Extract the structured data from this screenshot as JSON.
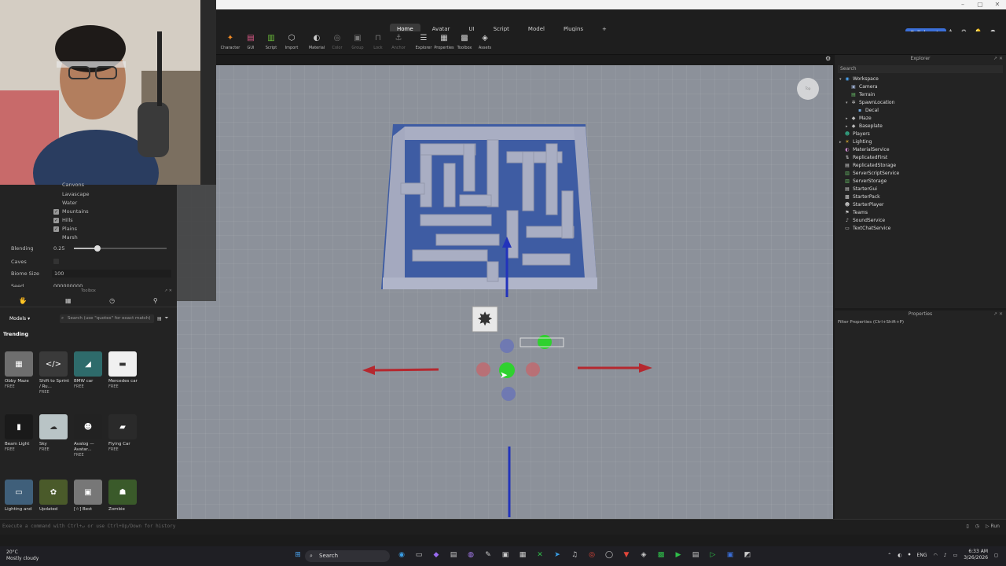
{
  "window": {
    "controls": [
      "–",
      "▢",
      "✕"
    ]
  },
  "ribbon": {
    "tabs": [
      {
        "label": "Home",
        "active": true
      },
      {
        "label": "Avatar"
      },
      {
        "label": "UI"
      },
      {
        "label": "Script"
      },
      {
        "label": "Model"
      },
      {
        "label": "Plugins"
      },
      {
        "label": "+"
      }
    ],
    "collaborate": "Collaborate",
    "tools": [
      {
        "label": "Character",
        "icon": "character-icon",
        "glyph": "✦",
        "color": "#f08a24"
      },
      {
        "label": "GUI",
        "icon": "gui-icon",
        "glyph": "▤",
        "color": "#e05a8a"
      },
      {
        "label": "Script",
        "icon": "script-icon",
        "glyph": "▥",
        "color": "#6bbf3a"
      },
      {
        "label": "Import",
        "icon": "import-icon",
        "glyph": "⬡",
        "color": "#cccccc"
      },
      {
        "label": "Material",
        "icon": "material-icon",
        "glyph": "◐",
        "color": "#cccccc"
      },
      {
        "label": "Color",
        "icon": "color-icon",
        "glyph": "◎",
        "color": "#777777",
        "dim": true
      },
      {
        "label": "Group",
        "icon": "group-icon",
        "glyph": "▣",
        "color": "#777777",
        "dim": true
      },
      {
        "label": "Lock",
        "icon": "lock-icon",
        "glyph": "⊓",
        "color": "#777777",
        "dim": true
      },
      {
        "label": "Anchor",
        "icon": "anchor-icon",
        "glyph": "⚓",
        "color": "#777777",
        "dim": true
      },
      {
        "label": "Explorer",
        "icon": "explorer-icon",
        "glyph": "☰",
        "color": "#cccccc"
      },
      {
        "label": "Properties",
        "icon": "properties-icon",
        "glyph": "▦",
        "color": "#cccccc"
      },
      {
        "label": "Toolbox",
        "icon": "toolbox-icon",
        "glyph": "▩",
        "color": "#cccccc"
      },
      {
        "label": "Assets",
        "icon": "assets-icon",
        "glyph": "◈",
        "color": "#cccccc"
      }
    ]
  },
  "terrain": {
    "options": [
      {
        "label": "Canyons",
        "checked": false
      },
      {
        "label": "Lavascape",
        "checked": false
      },
      {
        "label": "Water",
        "checked": false
      },
      {
        "label": "Mountains",
        "checked": true
      },
      {
        "label": "Hills",
        "checked": true
      },
      {
        "label": "Plains",
        "checked": true
      },
      {
        "label": "Marsh",
        "checked": false
      }
    ],
    "blending_label": "Blending",
    "blending_value": "0.25",
    "blending_fraction": 0.25,
    "caves_label": "Caves",
    "biome_size_label": "Biome Size",
    "biome_size_value": "100",
    "seed_label": "Seed",
    "seed_value": "000000000"
  },
  "toolbox": {
    "title": "Toolbox",
    "category": "Models",
    "search_placeholder": "Search (use \"quotes\" for exact match)",
    "section": "Trending",
    "items": [
      {
        "name": "Obby Maze",
        "price": "FREE",
        "glyph": "▦",
        "bg": "#6e6e6e"
      },
      {
        "name": "Shift to Sprint / Ru...",
        "price": "FREE",
        "glyph": "</>",
        "bg": "#3a3a3a"
      },
      {
        "name": "BMW car",
        "price": "FREE",
        "glyph": "◢",
        "bg": "#2e6b6b"
      },
      {
        "name": "Mercedes car",
        "price": "FREE",
        "glyph": "▬",
        "bg": "#f0f0f0"
      },
      {
        "name": "Beam Light",
        "price": "FREE",
        "glyph": "▮",
        "bg": "#1a1a1a"
      },
      {
        "name": "Sky",
        "price": "FREE",
        "glyph": "☁",
        "bg": "#b9c4c6"
      },
      {
        "name": "Avalog — Avatar...",
        "price": "FREE",
        "glyph": "☻",
        "bg": "#222222"
      },
      {
        "name": "Flying Car",
        "price": "FREE",
        "glyph": "▰",
        "bg": "#2a2a2a"
      },
      {
        "name": "Lighting and",
        "price": "",
        "glyph": "▭",
        "bg": "#3f5f7a"
      },
      {
        "name": "Updated",
        "price": "",
        "glyph": "✿",
        "bg": "#4a5a2a"
      },
      {
        "name": "[☆] Best",
        "price": "",
        "glyph": "▣",
        "bg": "#777777"
      },
      {
        "name": "Zombie",
        "price": "",
        "glyph": "☗",
        "bg": "#3a5a2a"
      }
    ]
  },
  "explorer": {
    "title": "Explorer",
    "search_placeholder": "Search",
    "tree": [
      {
        "label": "Workspace",
        "depth": 0,
        "arrow": "▾",
        "icon": "workspace-icon",
        "glyph": "◉",
        "color": "#4aa3f0"
      },
      {
        "label": "Camera",
        "depth": 1,
        "arrow": "",
        "icon": "camera-icon",
        "glyph": "▣",
        "color": "#9ac"
      },
      {
        "label": "Terrain",
        "depth": 1,
        "arrow": "",
        "icon": "terrain-icon",
        "glyph": "▤",
        "color": "#6b6"
      },
      {
        "label": "SpawnLocation",
        "depth": 1,
        "arrow": "▾",
        "icon": "spawn-icon",
        "glyph": "✲",
        "color": "#ccc"
      },
      {
        "label": "Decal",
        "depth": 2,
        "arrow": "",
        "icon": "decal-icon",
        "glyph": "▪",
        "color": "#7ad"
      },
      {
        "label": "Maze",
        "depth": 1,
        "arrow": "▸",
        "icon": "model-icon",
        "glyph": "◆",
        "color": "#bbb"
      },
      {
        "label": "Baseplate",
        "depth": 1,
        "arrow": "▸",
        "icon": "part-icon",
        "glyph": "◆",
        "color": "#bbb"
      },
      {
        "label": "Players",
        "depth": 0,
        "arrow": "",
        "icon": "players-icon",
        "glyph": "☻",
        "color": "#3a8"
      },
      {
        "label": "Lighting",
        "depth": 0,
        "arrow": "▸",
        "icon": "lighting-icon",
        "glyph": "☀",
        "color": "#eb3"
      },
      {
        "label": "MaterialService",
        "depth": 0,
        "arrow": "",
        "icon": "material-service-icon",
        "glyph": "◐",
        "color": "#c8c"
      },
      {
        "label": "ReplicatedFirst",
        "depth": 0,
        "arrow": "",
        "icon": "replicated-first-icon",
        "glyph": "⇅",
        "color": "#ccc"
      },
      {
        "label": "ReplicatedStorage",
        "depth": 0,
        "arrow": "",
        "icon": "replicated-storage-icon",
        "glyph": "▤",
        "color": "#ccc"
      },
      {
        "label": "ServerScriptService",
        "depth": 0,
        "arrow": "",
        "icon": "server-script-icon",
        "glyph": "▥",
        "color": "#6b6"
      },
      {
        "label": "ServerStorage",
        "depth": 0,
        "arrow": "",
        "icon": "server-storage-icon",
        "glyph": "▥",
        "color": "#6b6"
      },
      {
        "label": "StarterGui",
        "depth": 0,
        "arrow": "",
        "icon": "starter-gui-icon",
        "glyph": "▤",
        "color": "#ccc"
      },
      {
        "label": "StarterPack",
        "depth": 0,
        "arrow": "",
        "icon": "starter-pack-icon",
        "glyph": "▩",
        "color": "#ccc"
      },
      {
        "label": "StarterPlayer",
        "depth": 0,
        "arrow": "",
        "icon": "starter-player-icon",
        "glyph": "☻",
        "color": "#ccc"
      },
      {
        "label": "Teams",
        "depth": 0,
        "arrow": "",
        "icon": "teams-icon",
        "glyph": "⚑",
        "color": "#ccc"
      },
      {
        "label": "SoundService",
        "depth": 0,
        "arrow": "",
        "icon": "sound-icon",
        "glyph": "♪",
        "color": "#ccc"
      },
      {
        "label": "TextChatService",
        "depth": 0,
        "arrow": "",
        "icon": "chat-icon",
        "glyph": "▭",
        "color": "#ccc"
      }
    ]
  },
  "properties": {
    "title": "Properties",
    "filter_placeholder": "Filter Properties (Ctrl+Shift+P)"
  },
  "command_bar": {
    "placeholder": "Execute a command with Ctrl+↵ or use Ctrl+Up/Down for history",
    "run": "Run"
  },
  "viewport": {
    "camera_badge": "Top"
  },
  "taskbar": {
    "weather_temp": "20°C",
    "weather_desc": "Mostly cloudy",
    "search": "Search",
    "lang": "ENG",
    "time": "6:33 AM",
    "date": "3/26/2026"
  },
  "colors": {
    "accent": "#3b6fd8",
    "panel": "#232323",
    "viewport": "#8c919a"
  }
}
